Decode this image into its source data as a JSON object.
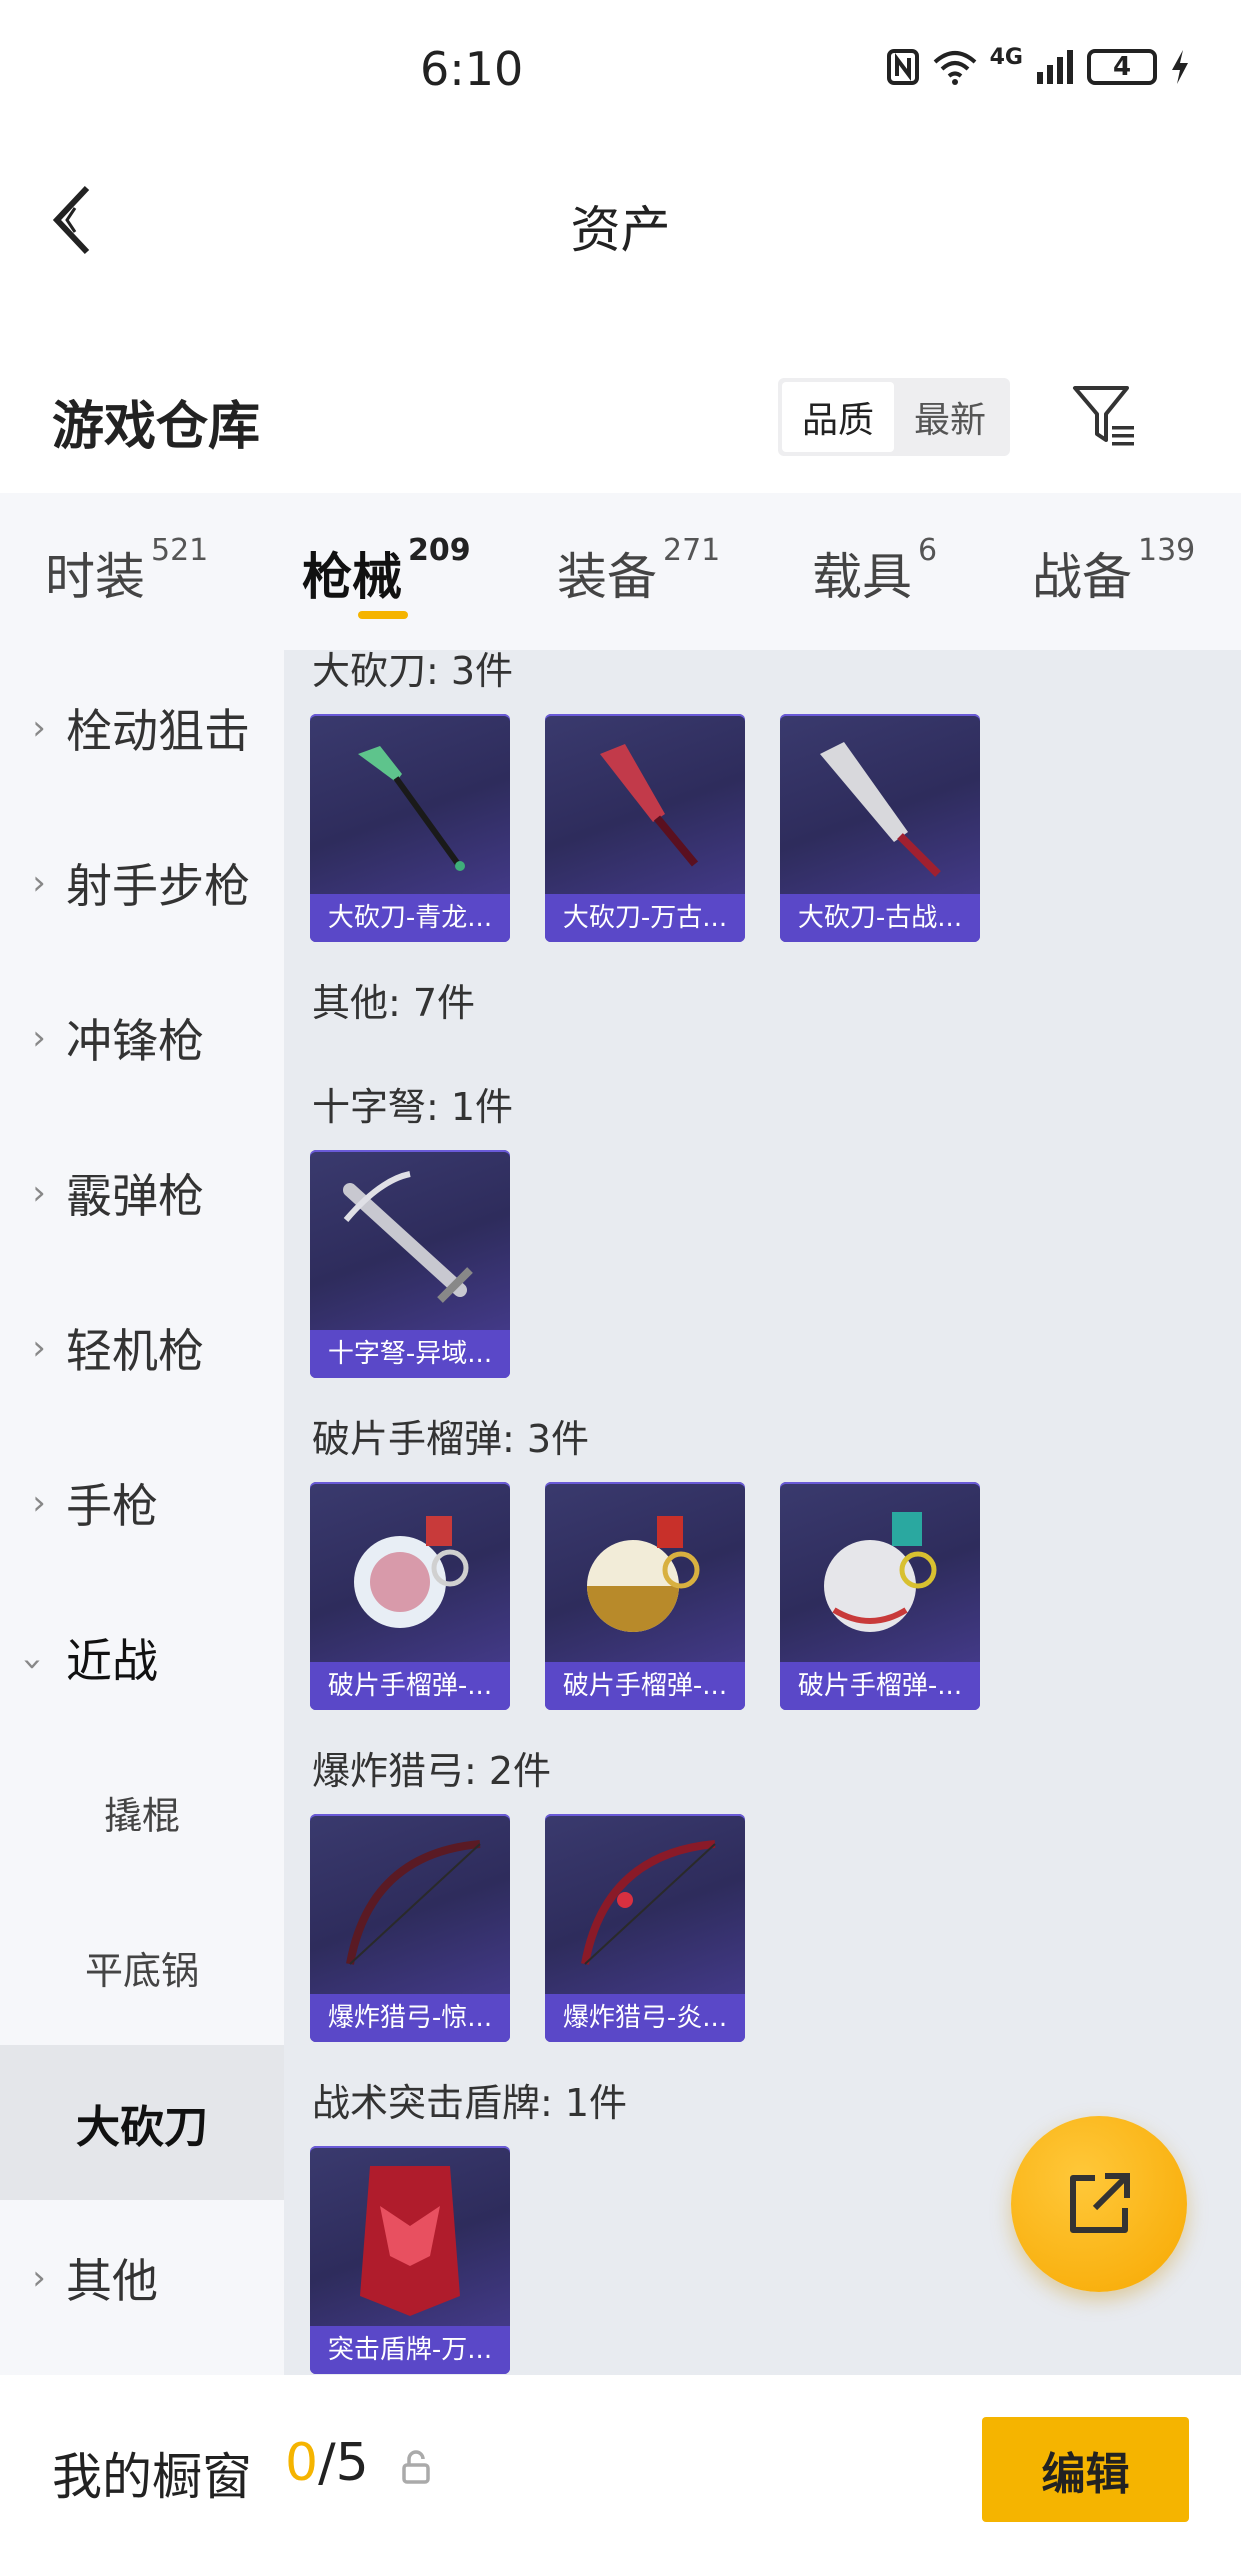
{
  "status": {
    "time": "6:10",
    "network": "4G",
    "battery": "4"
  },
  "header": {
    "title": "资产"
  },
  "warehouse": {
    "title": "游戏仓库",
    "sort_options": [
      "品质",
      "最新"
    ],
    "active_sort": "品质"
  },
  "tabs": [
    {
      "label": "时装",
      "count": "521"
    },
    {
      "label": "枪械",
      "count": "209"
    },
    {
      "label": "装备",
      "count": "271"
    },
    {
      "label": "载具",
      "count": "6"
    },
    {
      "label": "战备",
      "count": "139"
    }
  ],
  "sidebar": {
    "items": [
      "栓动狙击",
      "射手步枪",
      "冲锋枪",
      "霰弹枪",
      "轻机枪",
      "手枪",
      "近战"
    ],
    "sub_items": [
      "撬棍",
      "平底锅",
      "大砍刀"
    ],
    "after": "其他"
  },
  "groups": [
    {
      "title": "大砍刀: 3件",
      "items": [
        "大砍刀-青龙...",
        "大砍刀-万古...",
        "大砍刀-古战..."
      ]
    },
    {
      "title": "其他: 7件",
      "items": []
    },
    {
      "title": "十字弩: 1件",
      "items": [
        "十字弩-异域..."
      ]
    },
    {
      "title": "破片手榴弹: 3件",
      "items": [
        "破片手榴弹-...",
        "破片手榴弹-...",
        "破片手榴弹-..."
      ]
    },
    {
      "title": "爆炸猎弓: 2件",
      "items": [
        "爆炸猎弓-惊...",
        "爆炸猎弓-炎..."
      ]
    },
    {
      "title": "战术突击盾牌: 1件",
      "items": [
        "突击盾牌-万..."
      ]
    }
  ],
  "bottom": {
    "showcase_label": "我的橱窗",
    "showcase_current": "0",
    "showcase_total": "/5",
    "edit_label": "编辑"
  },
  "colors": {
    "accent": "#f5b400",
    "card_label": "#5a48c8"
  }
}
